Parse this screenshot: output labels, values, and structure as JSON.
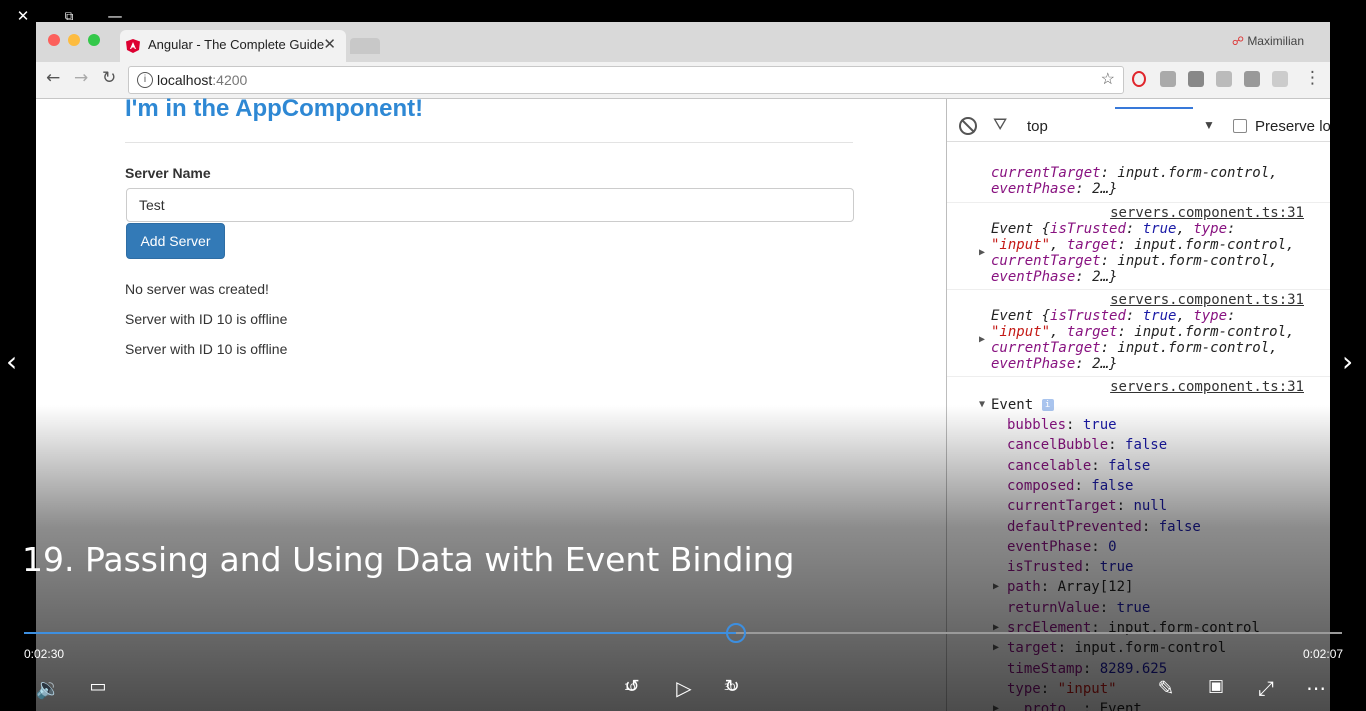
{
  "window_controls": {
    "close": "✕",
    "restore": "⧉",
    "minimize": "—"
  },
  "browser": {
    "tab_title": "Angular - The Complete Guide",
    "profile": "Maximilian",
    "url_host": "localhost",
    "url_port": ":4200"
  },
  "app": {
    "title": "I'm in the AppComponent!",
    "field_label": "Server Name",
    "field_value": "Test",
    "button_label": "Add Server",
    "status_text": "No server was created!",
    "servers": [
      "Server with ID 10 is offline",
      "Server with ID 10 is offline"
    ]
  },
  "devtools": {
    "context": "top",
    "preserve_log": "Preserve lo",
    "partial_line_1": "currentTarget: input.form-control,",
    "partial_line_2": "eventPhase: 2…}",
    "source": "servers.component.ts:31",
    "event_lines": [
      "Event {isTrusted: true, type:",
      "\"input\", target: input.form-control,",
      "currentTarget: input.form-control,",
      "eventPhase: 2…}"
    ],
    "expanded_label": "Event",
    "properties": [
      {
        "key": "bubbles",
        "value": "true",
        "expandable": false
      },
      {
        "key": "cancelBubble",
        "value": "false",
        "expandable": false
      },
      {
        "key": "cancelable",
        "value": "false",
        "expandable": false
      },
      {
        "key": "composed",
        "value": "false",
        "expandable": false
      },
      {
        "key": "currentTarget",
        "value": "null",
        "expandable": false
      },
      {
        "key": "defaultPrevented",
        "value": "false",
        "expandable": false
      },
      {
        "key": "eventPhase",
        "value": "0",
        "expandable": false
      },
      {
        "key": "isTrusted",
        "value": "true",
        "expandable": false
      },
      {
        "key": "path",
        "value": "Array[12]",
        "expandable": true
      },
      {
        "key": "returnValue",
        "value": "true",
        "expandable": false
      },
      {
        "key": "srcElement",
        "value": "input.form-control",
        "expandable": true
      },
      {
        "key": "target",
        "value": "input.form-control",
        "expandable": true
      },
      {
        "key": "timeStamp",
        "value": "8289.625",
        "expandable": false
      },
      {
        "key": "type",
        "value": "\"input\"",
        "expandable": false
      },
      {
        "key": "__proto__",
        "value": "Event",
        "expandable": true
      }
    ]
  },
  "player": {
    "video_title": "19. Passing and Using Data with Event Binding",
    "elapsed": "0:02:30",
    "remaining": "0:02:07",
    "progress_fraction": 0.54,
    "skip_back": "10",
    "skip_forward": "30",
    "accent_color": "#3d8fe0"
  }
}
